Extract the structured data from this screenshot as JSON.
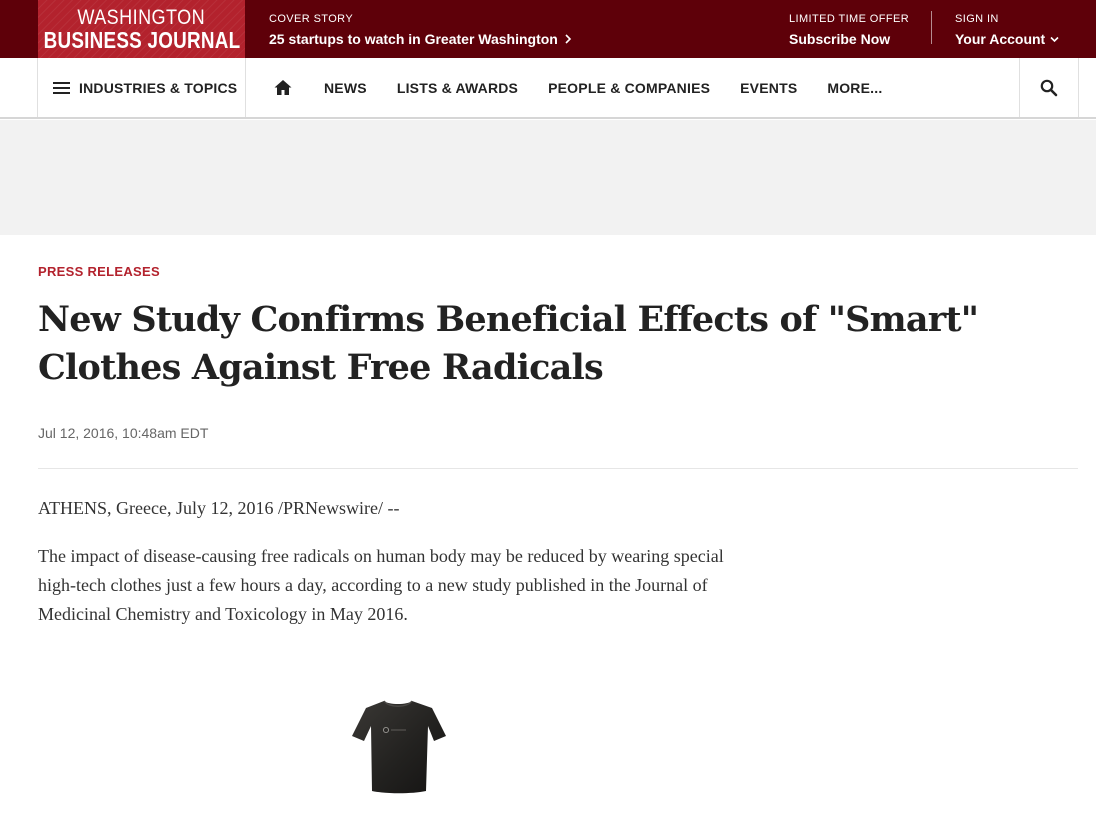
{
  "brand": {
    "logo_line1": "WASHINGTON",
    "logo_line2": "BUSINESS JOURNAL",
    "accent": "#b3222d",
    "topbar_bg": "#5e0009"
  },
  "topbar": {
    "cover_eyebrow": "COVER STORY",
    "cover_title": "25 startups to watch in Greater Washington",
    "offer_eyebrow": "LIMITED TIME OFFER",
    "offer_title": "Subscribe Now",
    "signin_eyebrow": "SIGN IN",
    "account_label": "Your Account"
  },
  "nav": {
    "industries_label": "INDUSTRIES & TOPICS",
    "home_icon": "home-icon",
    "items": [
      "NEWS",
      "LISTS & AWARDS",
      "PEOPLE & COMPANIES",
      "EVENTS",
      "MORE..."
    ],
    "search_icon": "search-icon"
  },
  "article": {
    "kicker": "PRESS RELEASES",
    "headline": "New Study Confirms Beneficial Effects of \"Smart\" Clothes Against Free Radicals",
    "date": "Jul 12, 2016, 10:48am EDT",
    "location_line": "ATHENS, Greece, July 12, 2016 /PRNewswire/ --",
    "paragraph": "The impact of disease-causing free radicals on human body may be reduced by wearing special high-tech clothes just a few hours a day, according to a new study published in the Journal of Medicinal Chemistry and Toxicology in May 2016."
  }
}
